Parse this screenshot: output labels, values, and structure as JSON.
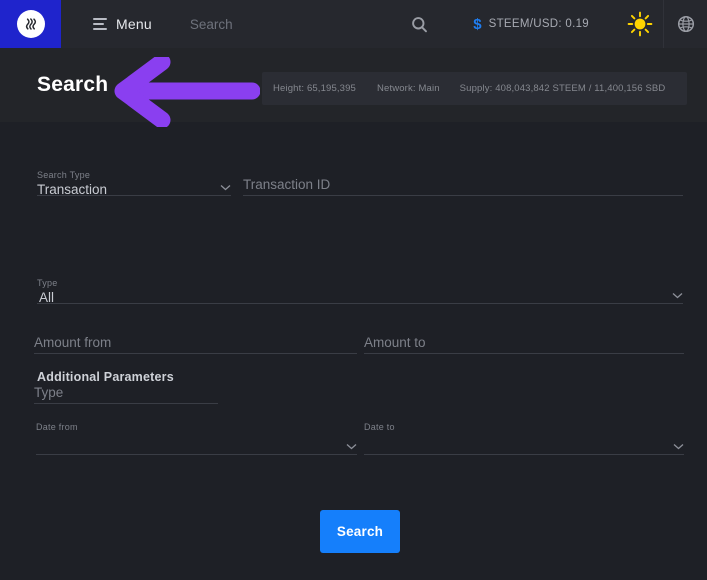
{
  "topnav": {
    "logo_icon": "steem-logo-icon",
    "menu_label": "Menu",
    "search_nav_label": "Search",
    "search_icon": "search-icon",
    "dollar_icon": "dollar-sign-icon",
    "price_label": "STEEM/USD: 0.19",
    "theme_icon": "sun-icon",
    "language_icon": "globe-icon"
  },
  "subheader": {
    "title": "Search",
    "stats": [
      "Height: 65,195,395",
      "Network: Main",
      "Supply: 408,043,842 STEEM / 11,400,156 SBD"
    ]
  },
  "annotation": {
    "arrow_icon": "left-arrow-annotation-icon",
    "color": "#8a3ff0"
  },
  "form": {
    "search_type": {
      "label": "Search Type",
      "value": "Transaction",
      "chevron_icon": "chevron-down-icon"
    },
    "transaction_id": {
      "placeholder": "Transaction ID",
      "value": ""
    },
    "section_title": "Additional Parameters",
    "type_select": {
      "label": "Type",
      "value": "All",
      "chevron_icon": "chevron-down-icon"
    },
    "amount_from": {
      "placeholder": "Amount from",
      "value": ""
    },
    "amount_to": {
      "placeholder": "Amount to",
      "value": ""
    },
    "type_input": {
      "placeholder": "Type",
      "value": ""
    },
    "date_from": {
      "label": "Date from",
      "value": "",
      "chevron_icon": "chevron-down-icon"
    },
    "date_to": {
      "label": "Date to",
      "value": "",
      "chevron_icon": "chevron-down-icon"
    },
    "submit_label": "Search"
  },
  "colors": {
    "accent_blue": "#157ffb",
    "logo_blue": "#1f24cc",
    "annotation_purple": "#8a3ff0",
    "page_bg": "#1e2026",
    "nav_bg": "#26282e"
  }
}
